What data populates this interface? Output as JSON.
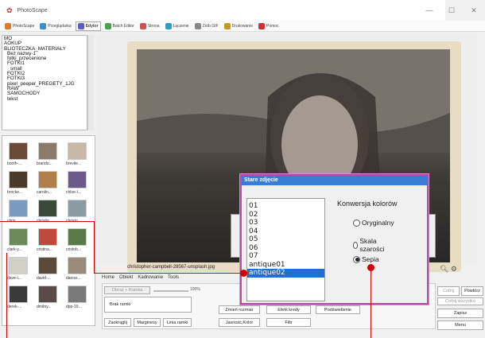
{
  "app": {
    "title": "PhotoScape"
  },
  "toolbar": {
    "items": [
      "PhotoScape",
      "Przeglądarka",
      "Edytor",
      "Batch Editor",
      "Strona",
      "Łączenie",
      "Zrób GIF",
      "Drukowanie",
      "Pomoc"
    ]
  },
  "folders": [
    "MO",
    "AOKUP",
    "BLIOTECZKA_MATERIAŁY",
    "Bez nazwy-1",
    "fotki_przecenione",
    "FOTKI1",
    "small",
    "FOTKI2",
    "FOTKI3",
    "pixel_peeper_PREGETY_1JG",
    "RAW",
    "SAMOCHODY",
    "tekst"
  ],
  "thumbs": {
    "row1": [
      "booth-...",
      "brando...",
      "brevite..."
    ],
    "row2": [
      "brocke...",
      "carolin...",
      "chloe-l..."
    ],
    "row3": [
      "chris...",
      "christia...",
      "christo..."
    ],
    "row4": [
      "clark-y...",
      "cristina...",
      "cristob..."
    ],
    "row5": [
      "dave-l...",
      "david-...",
      "daniss..."
    ],
    "row6": [
      "derek-...",
      "dmitriy...",
      "dpp-19..."
    ]
  },
  "photo": {
    "filename": "christopher-campbell-28567-unsplash.jpg"
  },
  "ribbon": {
    "tabs": [
      "Home",
      "Obiekt",
      "Kadrowanie",
      "Tools"
    ],
    "filter_label": "Obraz + Ramka",
    "zoom": "100%",
    "frame_select": "Brak ramki",
    "buttons": [
      "Zaokrąglij",
      "Marginesy",
      "Linia ramki"
    ],
    "mid_buttons": [
      "Zmień rozmiar",
      "Jasność,Kolor",
      "Efekt kredy",
      "Filtr",
      "Podświetlenie"
    ]
  },
  "right_buttons": [
    "Cofnij",
    "Powtórz",
    "Cofnij wszystko",
    "Zapisz",
    "Menu"
  ],
  "dialog": {
    "title": "Stare zdjęcie",
    "items": [
      "01",
      "02",
      "03",
      "04",
      "05",
      "06",
      "07",
      "antique01",
      "antique02"
    ],
    "selected_index": 8,
    "conversion_label": "Konwersja kolorów",
    "options": [
      "Oryginalny",
      "Skala szarości",
      "Sepia"
    ],
    "selected_option": "Sepia"
  },
  "colors": {
    "highlight": "#b34aa5",
    "annotation": "#cc0000",
    "selection": "#1e6fd0"
  }
}
